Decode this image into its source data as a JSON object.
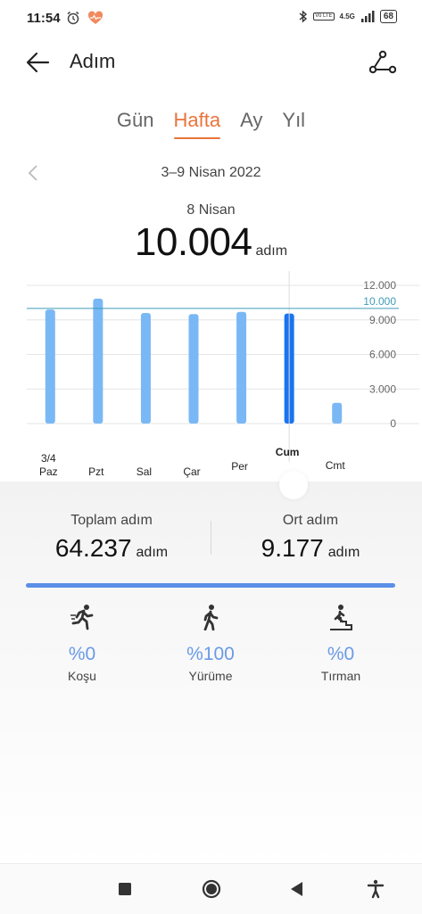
{
  "status": {
    "time": "11:54",
    "network": "4.5G",
    "volte": "Vo LTE",
    "battery": "68"
  },
  "header": {
    "title": "Adım"
  },
  "tabs": [
    {
      "label": "Gün",
      "active": false
    },
    {
      "label": "Hafta",
      "active": true
    },
    {
      "label": "Ay",
      "active": false
    },
    {
      "label": "Yıl",
      "active": false
    }
  ],
  "date_range": "3–9 Nisan 2022",
  "selected": {
    "date": "8 Nisan",
    "value": "10.004",
    "unit": "adım"
  },
  "chart_data": {
    "type": "bar",
    "categories": [
      "Paz",
      "Pzt",
      "Sal",
      "Çar",
      "Per",
      "Cum",
      "Cmt"
    ],
    "category_dates": [
      "3/4",
      "",
      "",
      "",
      "",
      "",
      ""
    ],
    "values": [
      9900,
      10850,
      9600,
      9500,
      9700,
      9550,
      1800
    ],
    "highlighted_index": 5,
    "goal": 10000,
    "goal_label": "10.000",
    "ylim": [
      0,
      12000
    ],
    "ytick_labels": [
      "12.000",
      "9.000",
      "6.000",
      "3.000",
      "0"
    ],
    "yticks": [
      12000,
      9000,
      6000,
      3000,
      0
    ],
    "bar_color": "#7ab8f5",
    "highlight_color": "#1a73f0",
    "goal_color": "#3f9bb8"
  },
  "summary": {
    "total_label": "Toplam adım",
    "total_value": "64.237",
    "total_unit": "adım",
    "avg_label": "Ort adım",
    "avg_value": "9.177",
    "avg_unit": "adım"
  },
  "activities": [
    {
      "icon": "running-icon",
      "pct": "%0",
      "label": "Koşu"
    },
    {
      "icon": "walking-icon",
      "pct": "%100",
      "label": "Yürüme"
    },
    {
      "icon": "climbing-icon",
      "pct": "%0",
      "label": "Tırman"
    }
  ],
  "colors": {
    "accent": "#e8743b",
    "progress": "#5b8fe8",
    "activity_pct": "#6a9ae6"
  }
}
